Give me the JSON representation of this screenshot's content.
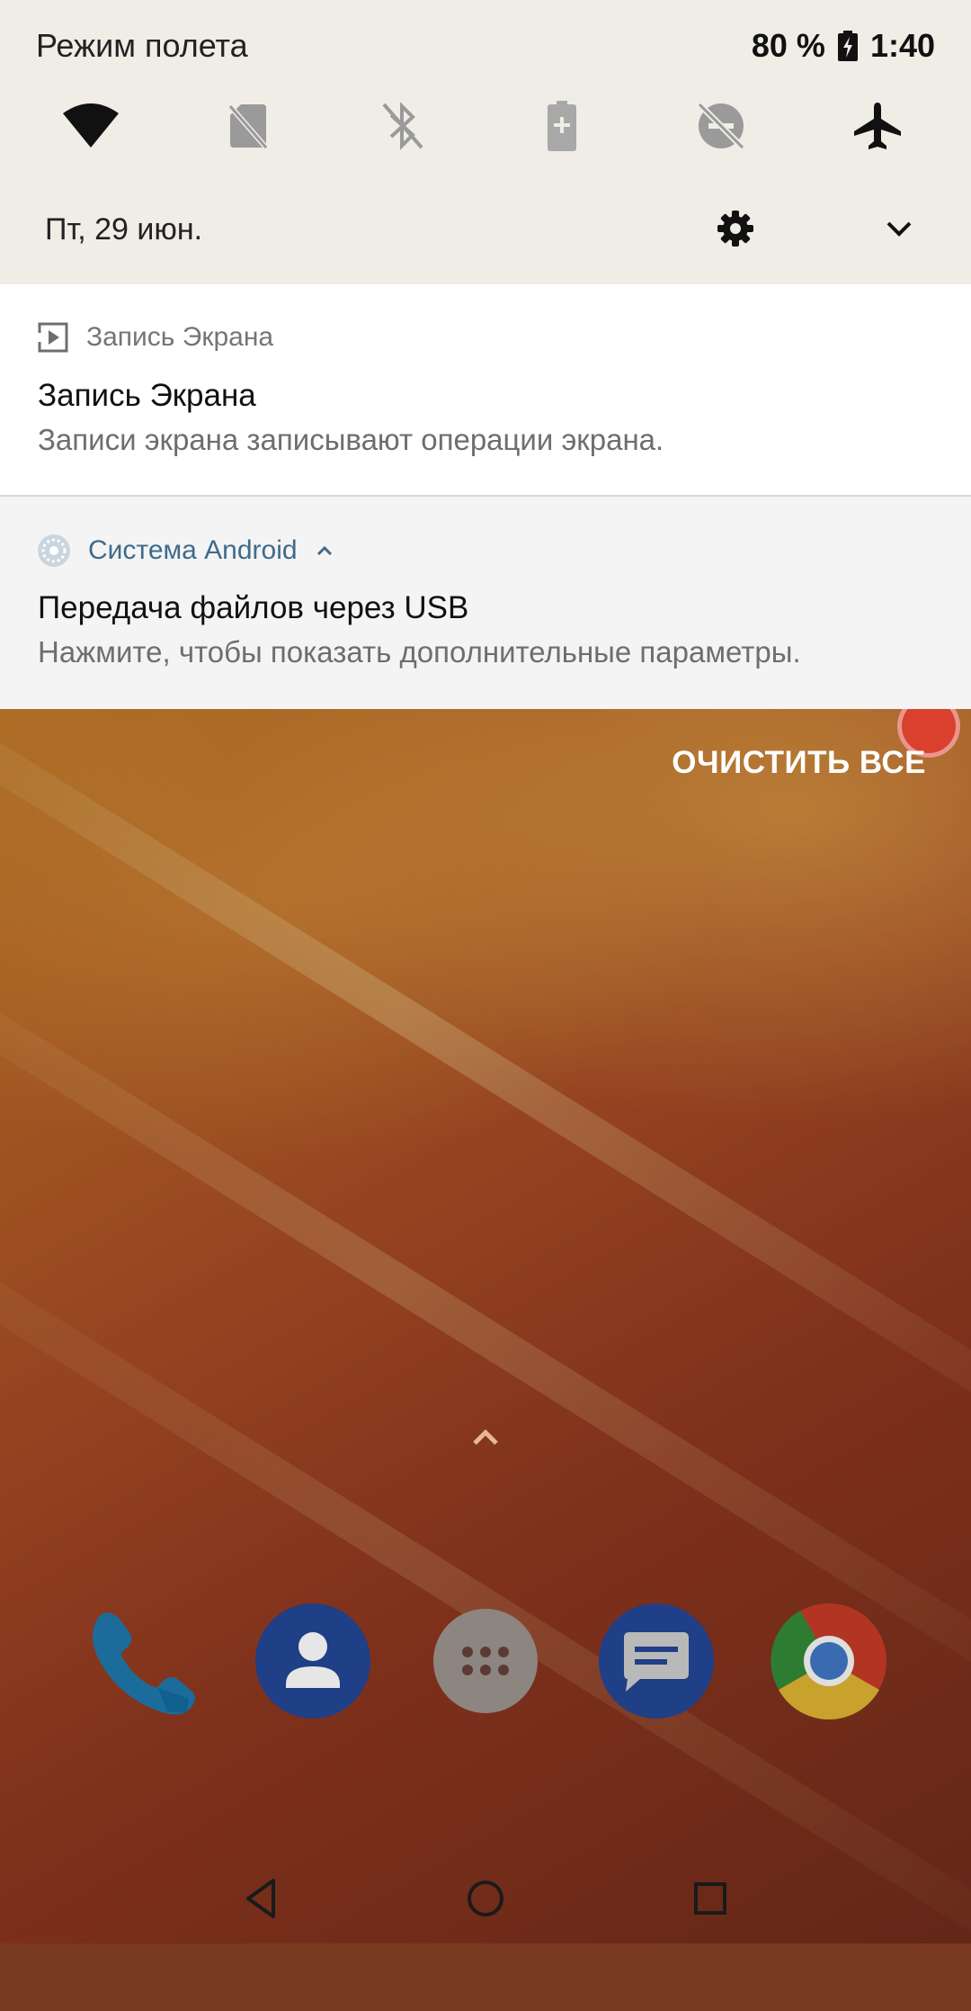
{
  "status_bar": {
    "mode_label": "Режим полета",
    "battery": "80 %",
    "time": "1:40"
  },
  "quick_settings": {
    "tiles": [
      {
        "name": "wifi-icon",
        "state": "on"
      },
      {
        "name": "no-sim-icon",
        "state": "off"
      },
      {
        "name": "bluetooth-off-icon",
        "state": "off"
      },
      {
        "name": "battery-saver-icon",
        "state": "off"
      },
      {
        "name": "do-not-disturb-off-icon",
        "state": "off"
      },
      {
        "name": "airplane-mode-icon",
        "state": "on"
      }
    ],
    "date": "Пт, 29 июн."
  },
  "notifications": [
    {
      "app": "Запись Экрана",
      "title": "Запись Экрана",
      "text": "Записи экрана записывают операции экрана."
    },
    {
      "app": "Система Android",
      "title": "Передача файлов через USB",
      "text": "Нажмите, чтобы показать дополнительные параметры."
    }
  ],
  "clear_all_label": "ОЧИСТИТЬ ВСЕ",
  "dock": [
    "phone-icon",
    "contacts-icon",
    "app-drawer-icon",
    "messages-icon",
    "chrome-icon"
  ],
  "colors": {
    "shade_bg": "#efede6",
    "accent_blue": "#3f6b8a",
    "wallpaper_orange": "#d7902f"
  }
}
